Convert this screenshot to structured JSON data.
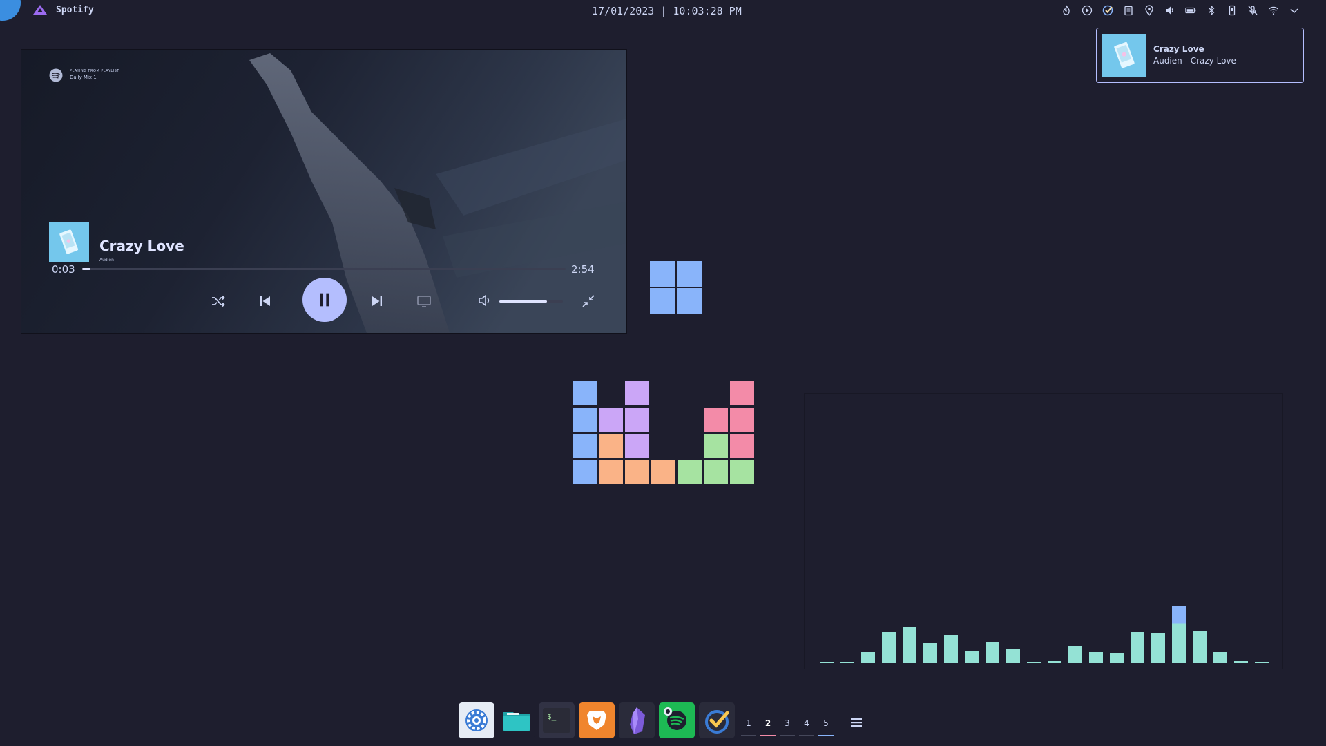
{
  "topbar": {
    "app_name": "Spotify",
    "datetime": "17/01/2023 | 10:03:28 PM",
    "tray_icons": [
      "fire-icon",
      "play-circle-icon",
      "task-check-icon",
      "clipboard-icon",
      "location-pin-icon",
      "speaker-icon",
      "battery-icon",
      "bluetooth-icon",
      "phone-icon",
      "mic-muted-icon",
      "wifi-icon",
      "chevron-down-icon"
    ]
  },
  "notification": {
    "title": "Crazy Love",
    "body": "Audien - Crazy Love"
  },
  "player": {
    "playing_from_label": "PLAYING FROM PLAYLIST",
    "playlist": "Daily Mix 1",
    "track_title": "Crazy Love",
    "artist": "Audien",
    "elapsed": "0:03",
    "duration": "2:54",
    "progress": 0.017,
    "volume": 0.75,
    "is_playing": true
  },
  "colors": {
    "background": "#1e1e2e",
    "text": "#cdd6f4",
    "accent": "#b4befe",
    "blue": "#89b4fa",
    "mauve": "#cba6f7",
    "peach": "#fab387",
    "green": "#a6e3a1",
    "pink": "#f38ba8",
    "teal": "#94e2d5"
  },
  "tetris": {
    "cols": 7,
    "rows": 4,
    "cells": [
      [
        0,
        0,
        "blue"
      ],
      [
        2,
        0,
        "mauve"
      ],
      [
        6,
        0,
        "pink"
      ],
      [
        0,
        1,
        "blue"
      ],
      [
        1,
        1,
        "mauve"
      ],
      [
        2,
        1,
        "mauve"
      ],
      [
        5,
        1,
        "pink"
      ],
      [
        6,
        1,
        "pink"
      ],
      [
        0,
        2,
        "blue"
      ],
      [
        1,
        2,
        "peach"
      ],
      [
        2,
        2,
        "mauve"
      ],
      [
        5,
        2,
        "green"
      ],
      [
        6,
        2,
        "pink"
      ],
      [
        0,
        3,
        "blue"
      ],
      [
        1,
        3,
        "peach"
      ],
      [
        2,
        3,
        "peach"
      ],
      [
        3,
        3,
        "peach"
      ],
      [
        4,
        3,
        "green"
      ],
      [
        5,
        3,
        "green"
      ],
      [
        6,
        3,
        "green"
      ]
    ]
  },
  "visualizer": {
    "levels": [
      0.01,
      0.01,
      0.2,
      0.55,
      0.65,
      0.35,
      0.5,
      0.22,
      0.37,
      0.25,
      0.01,
      0.04,
      0.3,
      0.2,
      0.18,
      0.55,
      0.52,
      1.0,
      0.56,
      0.19,
      0.04,
      0.01
    ]
  },
  "dock": {
    "apps": [
      {
        "name": "settings-app",
        "icon": "gear-icon"
      },
      {
        "name": "files-app",
        "icon": "folder-icon"
      },
      {
        "name": "terminal-app",
        "icon": "terminal-icon",
        "label": "$_"
      },
      {
        "name": "brave-app",
        "icon": "brave-lion-icon"
      },
      {
        "name": "obsidian-app",
        "icon": "obsidian-gem-icon"
      },
      {
        "name": "spotify-app",
        "icon": "spotify-icon"
      },
      {
        "name": "tasks-app",
        "icon": "checkmark-icon"
      }
    ],
    "workspaces": [
      "1",
      "2",
      "3",
      "4",
      "5"
    ],
    "active_workspace": "2"
  }
}
